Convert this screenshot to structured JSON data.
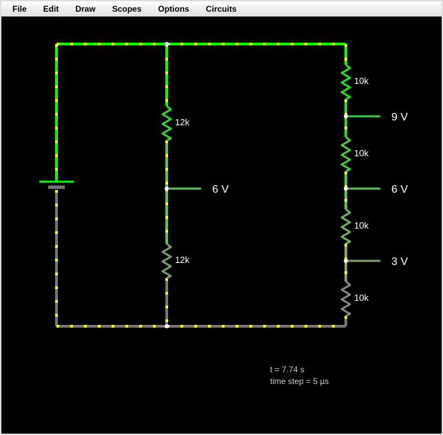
{
  "menu": {
    "file": "File",
    "edit": "Edit",
    "draw": "Draw",
    "scopes": "Scopes",
    "options": "Options",
    "circuits": "Circuits"
  },
  "labels": {
    "r_top_right": "10k",
    "r_mid1_right": "10k",
    "r_mid2_right": "10k",
    "r_bot_right": "10k",
    "r_top_center": "12k",
    "r_bot_center": "12k",
    "v_center": "6 V",
    "v_right_top": "9 V",
    "v_right_mid": "6 V",
    "v_right_bot": "3 V"
  },
  "status": {
    "time": "t = 7.74 s",
    "step": "time step = 5 µs"
  },
  "colors": {
    "top_rail": "#00ff00",
    "hi": "#00ff00",
    "mid": "#58c058",
    "low": "#80a070",
    "neg": "#777777"
  }
}
